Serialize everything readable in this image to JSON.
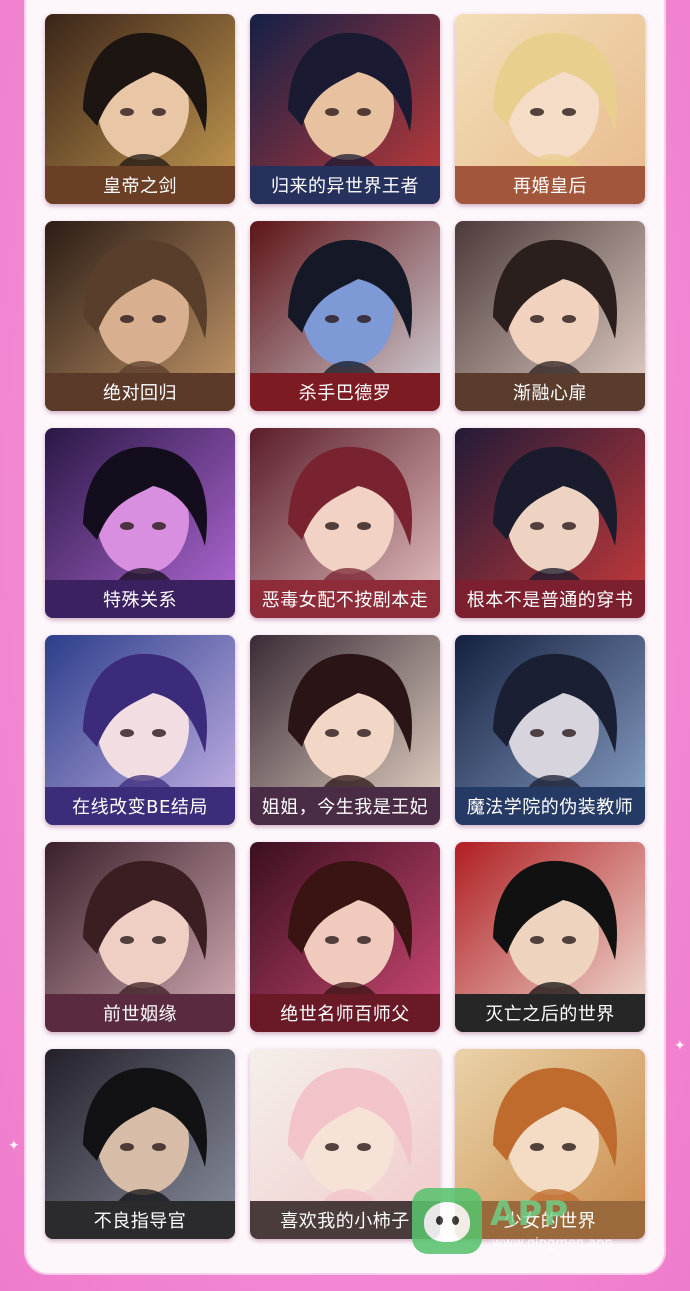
{
  "titles": [
    {
      "label": "皇帝之剑",
      "bar": "#6b3f26",
      "bg1": "#3a2418",
      "bg2": "#c89c52",
      "hair": "#1d1512",
      "skin": "#e9c7a6"
    },
    {
      "label": "归来的异世界王者",
      "bar": "#27315e",
      "bg1": "#142047",
      "bg2": "#c23a3a",
      "hair": "#1b1a33",
      "skin": "#e8c2a0"
    },
    {
      "label": "再婚皇后",
      "bar": "#a2563b",
      "bg1": "#f2dfb8",
      "bg2": "#e9b98c",
      "hair": "#e8cf8e",
      "skin": "#f4dcc6"
    },
    {
      "label": "绝对回归",
      "bar": "#5b3a29",
      "bg1": "#2b1c15",
      "bg2": "#c79a6b",
      "hair": "#5a3e2c",
      "skin": "#d9b08f"
    },
    {
      "label": "杀手巴德罗",
      "bar": "#7d1b22",
      "bg1": "#5e1418",
      "bg2": "#d6d6dc",
      "hair": "#151826",
      "skin": "#7e9ad6"
    },
    {
      "label": "渐融心扉",
      "bar": "#5a3c2c",
      "bg1": "#4b3a3a",
      "bg2": "#e7d3c9",
      "hair": "#2a1f1d",
      "skin": "#f0d2bf"
    },
    {
      "label": "特殊关系",
      "bar": "#3c2161",
      "bg1": "#2a1846",
      "bg2": "#b46ad8",
      "hair": "#140d1e",
      "skin": "#d88fe0"
    },
    {
      "label": "恶毒女配不按剧本走",
      "bar": "#8e2c3a",
      "bg1": "#5a1d2a",
      "bg2": "#e7c4c4",
      "hair": "#7a2330",
      "skin": "#f1d2c4"
    },
    {
      "label": "根本不是普通的穿书",
      "bar": "#7c1f2f",
      "bg1": "#231b38",
      "bg2": "#c93a3a",
      "hair": "#1a1b2c",
      "skin": "#efd3c2"
    },
    {
      "label": "在线改变BE结局",
      "bar": "#3c2c7a",
      "bg1": "#2c3e8a",
      "bg2": "#c8b4e8",
      "hair": "#3b2b7a",
      "skin": "#f2dde2"
    },
    {
      "label": "姐姐，今生我是王妃",
      "bar": "#4b2c46",
      "bg1": "#3a2a36",
      "bg2": "#e8d8c8",
      "hair": "#2a1416",
      "skin": "#f2d6c6"
    },
    {
      "label": "魔法学院的伪装教师",
      "bar": "#263a66",
      "bg1": "#15203f",
      "bg2": "#8aa2c8",
      "hair": "#1a1f33",
      "skin": "#d8d4de"
    },
    {
      "label": "前世姻缘",
      "bar": "#5a2a40",
      "bg1": "#3a1f2a",
      "bg2": "#d7b0b8",
      "hair": "#3a1e22",
      "skin": "#efcfc4"
    },
    {
      "label": "绝世名师百师父",
      "bar": "#6a1a26",
      "bg1": "#3b0f1e",
      "bg2": "#d04a78",
      "hair": "#3a1412",
      "skin": "#f0cbbd"
    },
    {
      "label": "灭亡之后的世界",
      "bar": "#262626",
      "bg1": "#b01e23",
      "bg2": "#f2e4d8",
      "hair": "#111111",
      "skin": "#eed4bf"
    },
    {
      "label": "不良指导官",
      "bar": "#2b2b2e",
      "bg1": "#23202a",
      "bg2": "#8a8f9e",
      "hair": "#121214",
      "skin": "#d7bca8"
    },
    {
      "label": "喜欢我的小柿子",
      "bar": "#4a3c3a",
      "bg1": "#f4efea",
      "bg2": "#f0c9c9",
      "hair": "#f2c3c8",
      "skin": "#f7e2d8"
    },
    {
      "label": "少女的世界",
      "bar": "#9b6a3c",
      "bg1": "#e9d2a8",
      "bg2": "#c98a4a",
      "hair": "#c06b2e",
      "skin": "#f4dcc4"
    }
  ],
  "watermark": {
    "brand": "APP",
    "url": "www.qingmen.app",
    "color": "#59c36e"
  }
}
